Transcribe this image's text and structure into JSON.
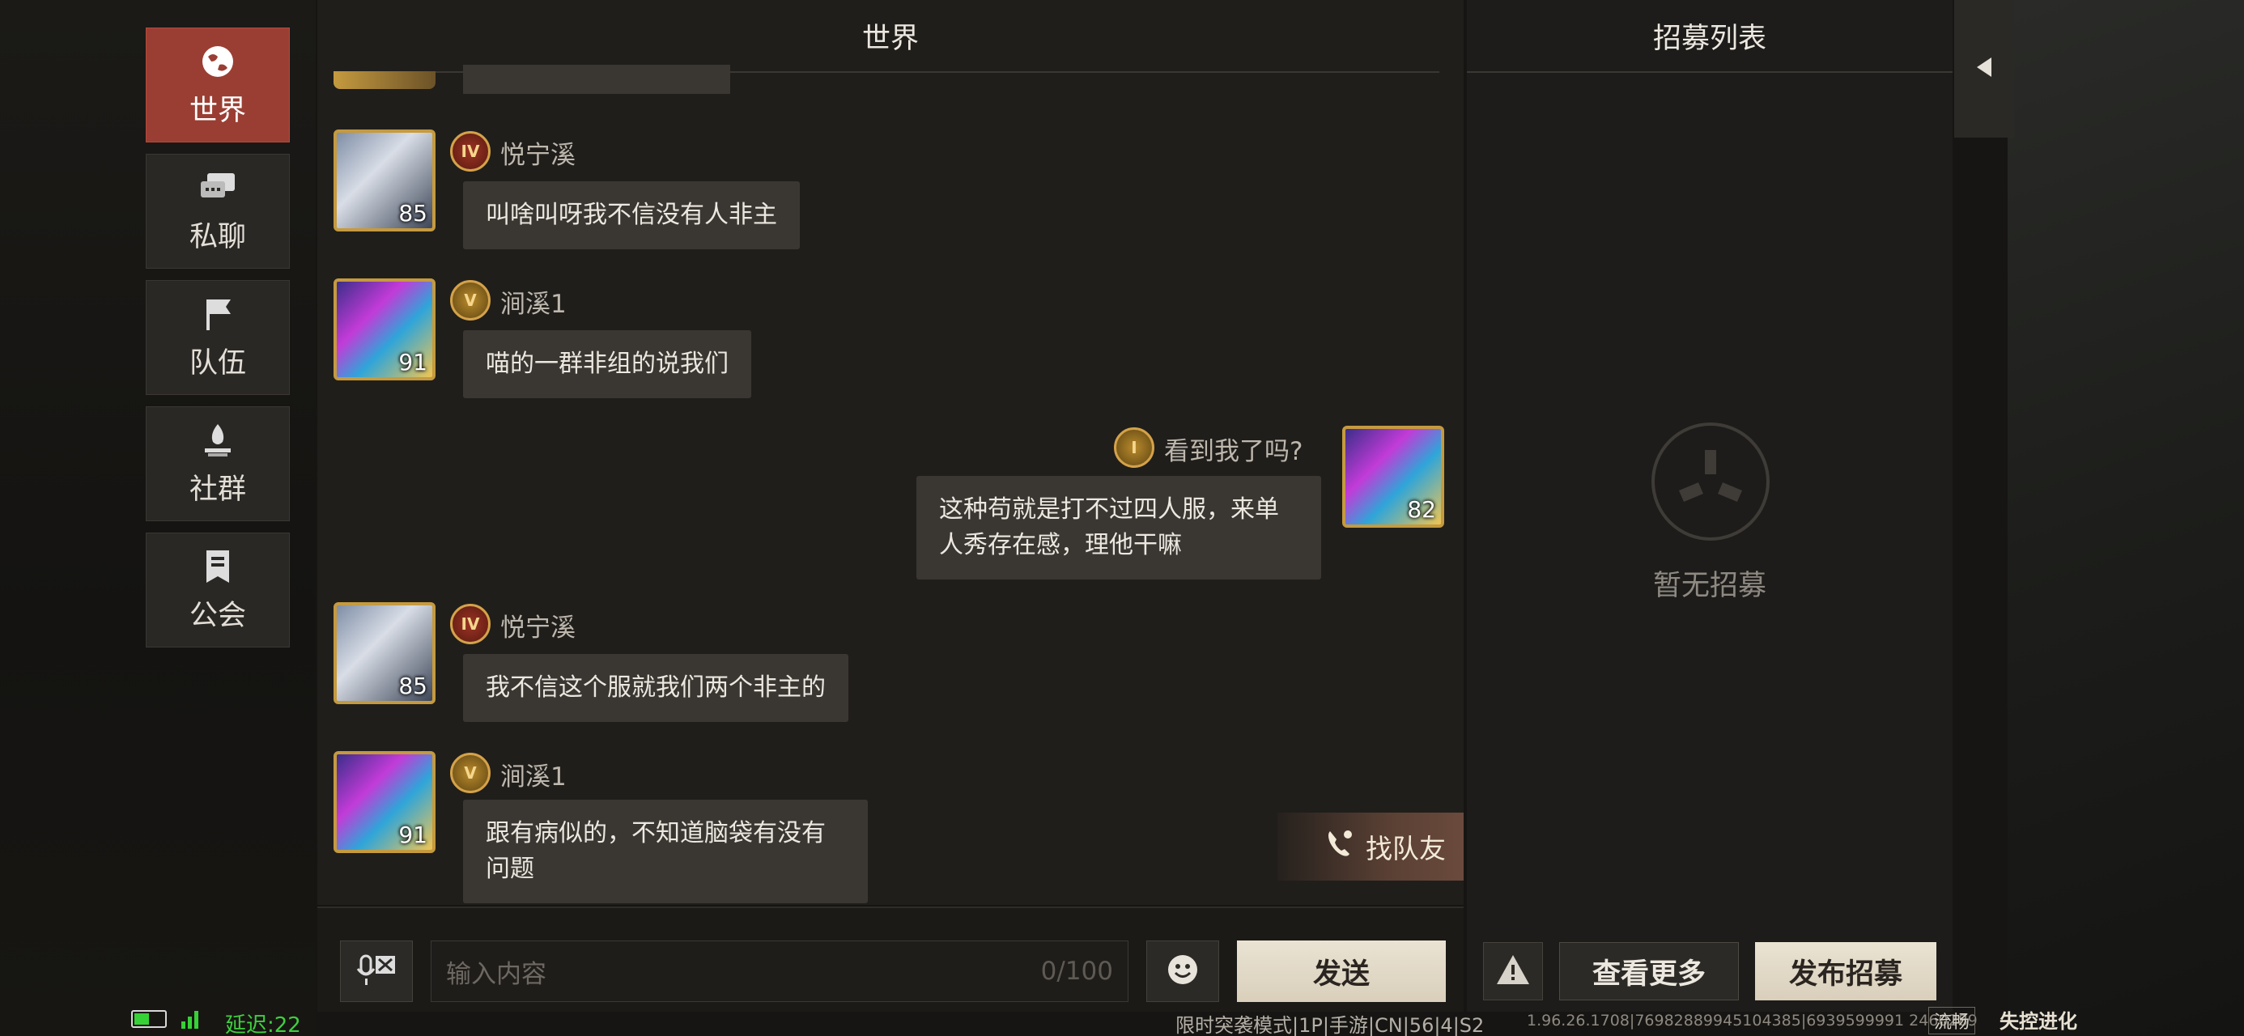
{
  "sidebar": {
    "tabs": [
      {
        "label": "世界",
        "icon": "globe-icon",
        "active": true
      },
      {
        "label": "私聊",
        "icon": "chat-bubbles-icon",
        "active": false
      },
      {
        "label": "队伍",
        "icon": "flag-icon",
        "active": false
      },
      {
        "label": "社群",
        "icon": "campfire-icon",
        "active": false
      },
      {
        "label": "公会",
        "icon": "guild-banner-icon",
        "active": false
      }
    ]
  },
  "chat": {
    "title": "世界",
    "messages": [
      {
        "user": "悦宁溪",
        "rank": "IV",
        "level": "85",
        "text": "叫啥叫呀我不信没有人非主",
        "side": "left"
      },
      {
        "user": "涧溪1",
        "rank": "V",
        "level": "91",
        "text": "喵的一群非组的说我们",
        "side": "left"
      },
      {
        "user": "看到我了吗?",
        "rank": "I",
        "level": "82",
        "text": "这种苟就是打不过四人服，来单人秀存在感，理他干嘛",
        "side": "right"
      },
      {
        "user": "悦宁溪",
        "rank": "IV",
        "level": "85",
        "text": "我不信这个服就我们两个非主的",
        "side": "left"
      },
      {
        "user": "涧溪1",
        "rank": "V",
        "level": "91",
        "text": "跟有病似的，不知道脑袋有没有问题",
        "side": "left"
      }
    ],
    "find_team_label": "找队友",
    "input_placeholder": "输入内容",
    "char_counter": "0/100",
    "send_label": "发送"
  },
  "recruit": {
    "title": "招募列表",
    "empty_text": "暂无招募",
    "more_label": "查看更多",
    "publish_label": "发布招募"
  },
  "status_bar": {
    "latency": "延迟:22",
    "server_info": "限时突袭模式|1P|手游|CN|56|4|S2",
    "build_info": "1.96.26.1708|76982889945104385|6939599991 2460289",
    "quality": "流畅",
    "game_logo": "失控进化"
  }
}
